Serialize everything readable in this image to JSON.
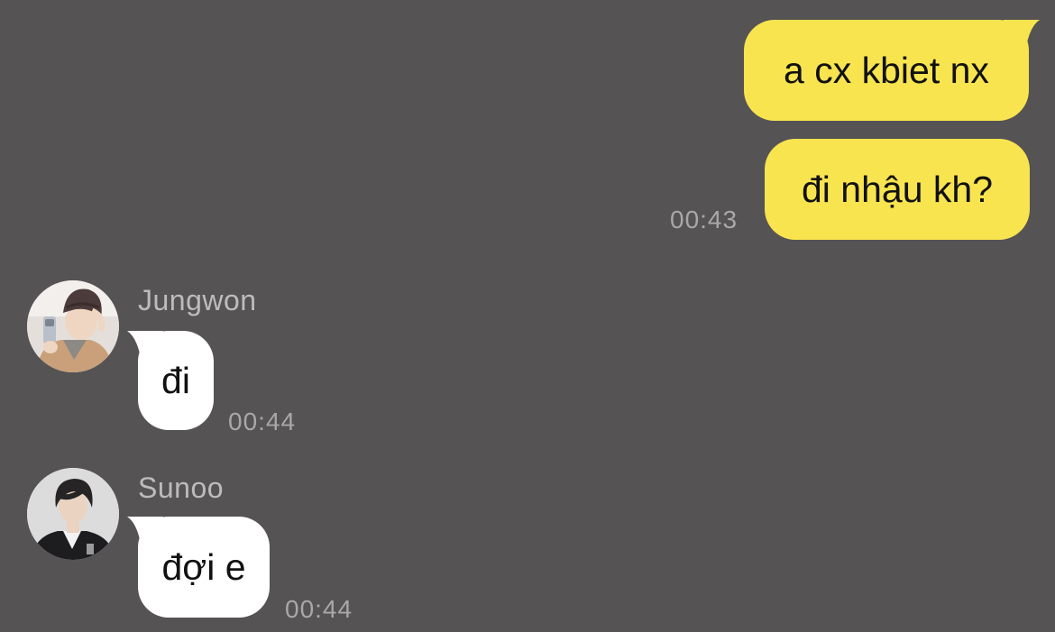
{
  "conversation": {
    "outgoing": [
      {
        "text": "a cx kbiet nx"
      },
      {
        "text": "đi nhậu kh?"
      }
    ],
    "outgoing_time": "00:43",
    "incoming": [
      {
        "sender": "Jungwon",
        "text": "đi",
        "time": "00:44",
        "avatar_icon": "profile-photo-beanie"
      },
      {
        "sender": "Sunoo",
        "text": "đợi e",
        "time": "00:44",
        "avatar_icon": "profile-photo-dark-hair"
      }
    ]
  },
  "colors": {
    "background": "#555354",
    "outgoing_bubble": "#f8e44f",
    "incoming_bubble": "#ffffff",
    "timestamp": "#a9a7a8",
    "sender_name": "#bdbbbc"
  }
}
